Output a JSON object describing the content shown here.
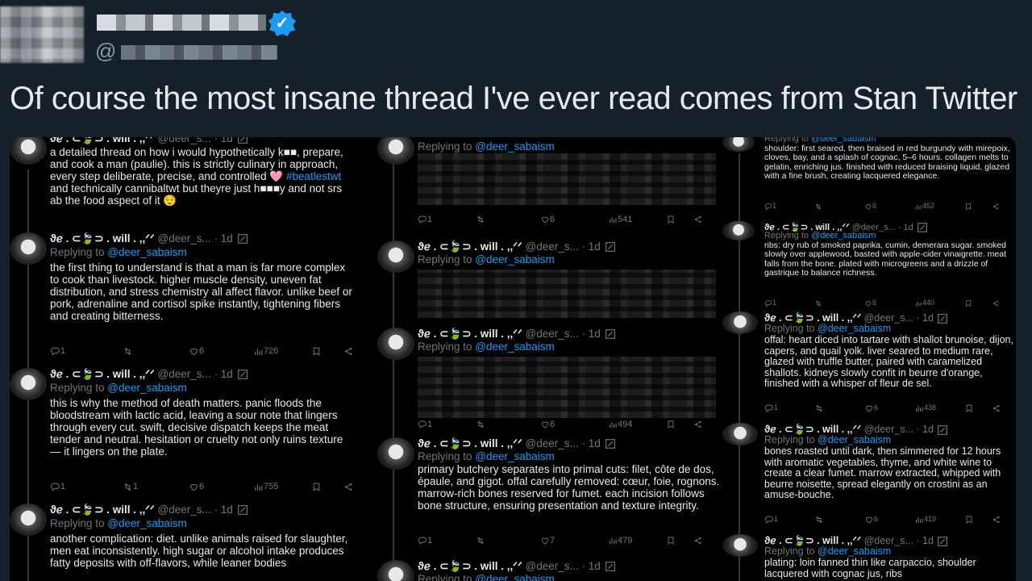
{
  "header": {
    "verified_mark": "✓",
    "handle_prefix": "@",
    "headline": "Of course the most insane thread I've ever read comes from Stan Twitter"
  },
  "author": {
    "name": "ϑℯ . ⊂🍃⊃ . will . ,,ᐟ⁠⁠ᐟ",
    "handle": "@deer_s...",
    "time": "· 1d",
    "replying_label": "Replying to",
    "replying_handle": "@deer_sabaism"
  },
  "icons": {
    "reply": "reply-icon",
    "retweet": "retweet-icon",
    "like": "heart-icon",
    "views": "views-icon",
    "bookmark": "bookmark-icon",
    "share": "share-icon",
    "grok": "grok-icon"
  },
  "col1": [
    {
      "body_parts": [
        "a detailed thread on how i would hypothetically k■■, prepare, and cook a man (paulie). this is strictly culinary in approach, every step deliberate, precise, and controlled 🩷 ",
        "#beatlestwt",
        " and technically cannibaltwt but theyre just h■■■y and not srs ab the food aspect of it 😌"
      ]
    },
    {
      "body": "the first thing to understand is that a man is far more complex to cook than livestock. higher muscle density, uneven fat distribution, and stress chemistry all affect flavor. unlike beef or pork, adrenaline and cortisol spike instantly, tightening fibers and creating bitterness.",
      "replies": "1",
      "retweets": "",
      "likes": "6",
      "views": "726"
    },
    {
      "body": "this is why the method of death matters. panic floods the bloodstream with lactic acid, leaving a sour note that lingers through every cut. swift, decisive dispatch keeps the meat tender and neutral. hesitation or cruelty not only ruins texture — it lingers on the plate.",
      "replies": "1",
      "retweets": "1",
      "likes": "6",
      "views": "755"
    },
    {
      "body": "another complication: diet. unlike animals raised for slaughter, men eat inconsistently. high sugar or alcohol intake produces fatty deposits with off-flavors, while leaner bodies"
    }
  ],
  "col2": [
    {
      "replies": "1",
      "retweets": "",
      "likes": "6",
      "views": "541"
    },
    {},
    {
      "replies": "1",
      "retweets": "",
      "likes": "6",
      "views": "494"
    },
    {
      "body": "primary butchery separates into primal cuts: filet, côte de dos, épaule, and gigot. offal carefully removed: cœur, foie, rognons. marrow-rich bones reserved for fumet. each incision follows bone structure, ensuring presentation and texture integrity.",
      "replies": "1",
      "retweets": "",
      "likes": "7",
      "views": "479"
    },
    {}
  ],
  "col3": [
    {
      "body": "shoulder: first seared, then braised in red burgundy with mirepoix, cloves, bay, and a splash of cognac, 5–6 hours. collagen melts to gelatin, enriching jus. finished with reduced braising liquid, glazed with a fine brush, creating lacquered elegance.",
      "replies": "1",
      "retweets": "",
      "likes": "6",
      "views": "452"
    },
    {
      "body": "ribs: dry rub of smoked paprika, cumin, demerara sugar. smoked slowly over applewood, basted with apple-cider vinaigrette. meat falls from the bone. plated with microgreens and a drizzle of gastrique to balance richness.",
      "replies": "1",
      "retweets": "",
      "likes": "6",
      "views": "440"
    },
    {
      "body": "offal: heart diced into tartare with shallot brunoise, dijon, capers, and quail yolk. liver seared to medium rare, glazed with truffle butter, paired with caramelized shallots. kidneys slowly confit in beurre d'orange, finished with a whisper of fleur de sel.",
      "replies": "1",
      "retweets": "",
      "likes": "6",
      "views": "438"
    },
    {
      "body": "bones roasted until dark, then simmered for 12 hours with aromatic vegetables, thyme, and white wine to create a clear fumet. marrow extracted, whipped with beurre noisette, spread elegantly on crostini as an amuse-bouche.",
      "replies": "1",
      "retweets": "",
      "likes": "6",
      "views": "419"
    },
    {
      "body": "plating: loin fanned thin like carpaccio, shoulder lacquered with cognac jus, ribs"
    }
  ]
}
